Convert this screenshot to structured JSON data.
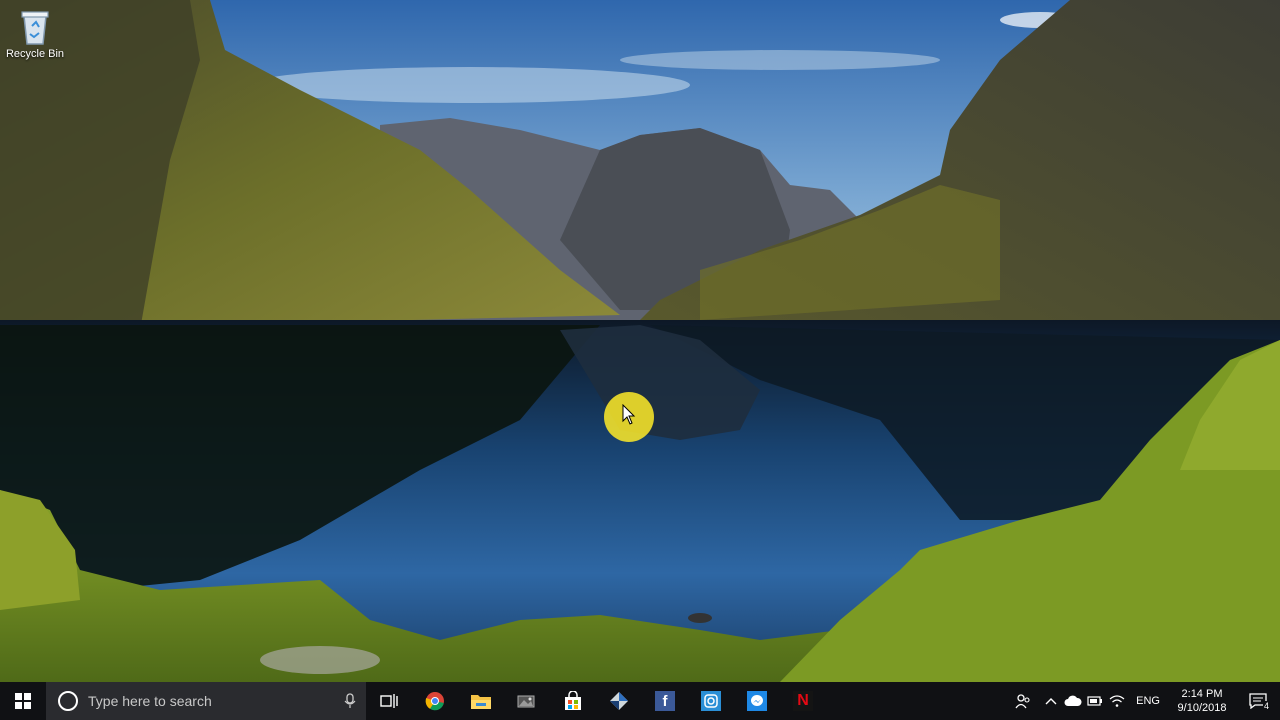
{
  "desktop": {
    "icons": [
      {
        "label": "Recycle Bin",
        "icon": "recycle-bin-icon"
      }
    ]
  },
  "taskbar": {
    "start": {
      "icon": "windows-logo-icon"
    },
    "search": {
      "placeholder": "Type here to search",
      "icon": "cortana-circle-icon",
      "mic_icon": "microphone-icon"
    },
    "apps": [
      {
        "name": "task-view",
        "icon": "task-view-icon"
      },
      {
        "name": "chrome",
        "icon": "chrome-icon",
        "color": "#e0442f"
      },
      {
        "name": "file-explorer",
        "icon": "folder-icon",
        "color": "#f4c245"
      },
      {
        "name": "photos",
        "icon": "photos-icon"
      },
      {
        "name": "store",
        "icon": "store-bag-icon"
      },
      {
        "name": "app-diamond",
        "icon": "diamond-icon"
      },
      {
        "name": "facebook",
        "icon": "facebook-icon",
        "color": "#3b5998",
        "glyph": "f"
      },
      {
        "name": "instagram",
        "icon": "instagram-icon",
        "color": "#2b8fd6"
      },
      {
        "name": "messenger",
        "icon": "messenger-icon",
        "color": "#1e88e5"
      },
      {
        "name": "netflix",
        "icon": "netflix-icon",
        "color": "#e50914",
        "glyph": "N"
      }
    ],
    "tray": {
      "icons": [
        "people-icon",
        "chevron-up-icon",
        "onedrive-icon",
        "battery-icon",
        "wifi-icon"
      ],
      "language": "ENG",
      "time": "2:14 PM",
      "date": "9/10/2018",
      "notifications_count": "4"
    }
  }
}
